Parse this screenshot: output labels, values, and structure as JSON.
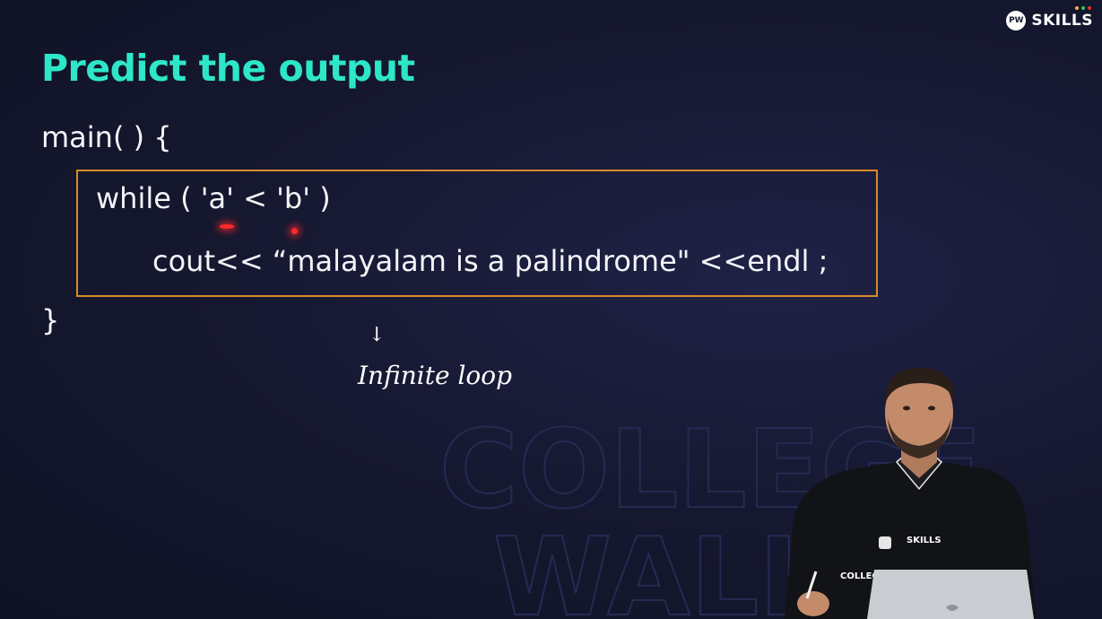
{
  "brand": {
    "logo_initials": "PW",
    "logo_text": "SKILLS",
    "dot_colors": [
      "#f5b73b",
      "#38c172",
      "#e3342f"
    ]
  },
  "slide": {
    "title": "Predict the output",
    "code": {
      "line1": "main( ) {",
      "line2": "while ( 'a' < 'b' )",
      "line3": "cout<< “malayalam is a palindrome\" <<endl ;",
      "line4": "}"
    },
    "colors": {
      "title": "#2ee6c8",
      "box_border": "#d98a2b",
      "background": "#15172e",
      "laser": "#ff2a2a"
    }
  },
  "annotation": {
    "arrow": "↓",
    "text": "Infinite loop"
  },
  "watermark": {
    "line1": "COLLEGE",
    "line2": "WALLAH"
  },
  "presenter": {
    "shirt_logo": "SKILLS",
    "shirt_text": "COLLEGE"
  }
}
